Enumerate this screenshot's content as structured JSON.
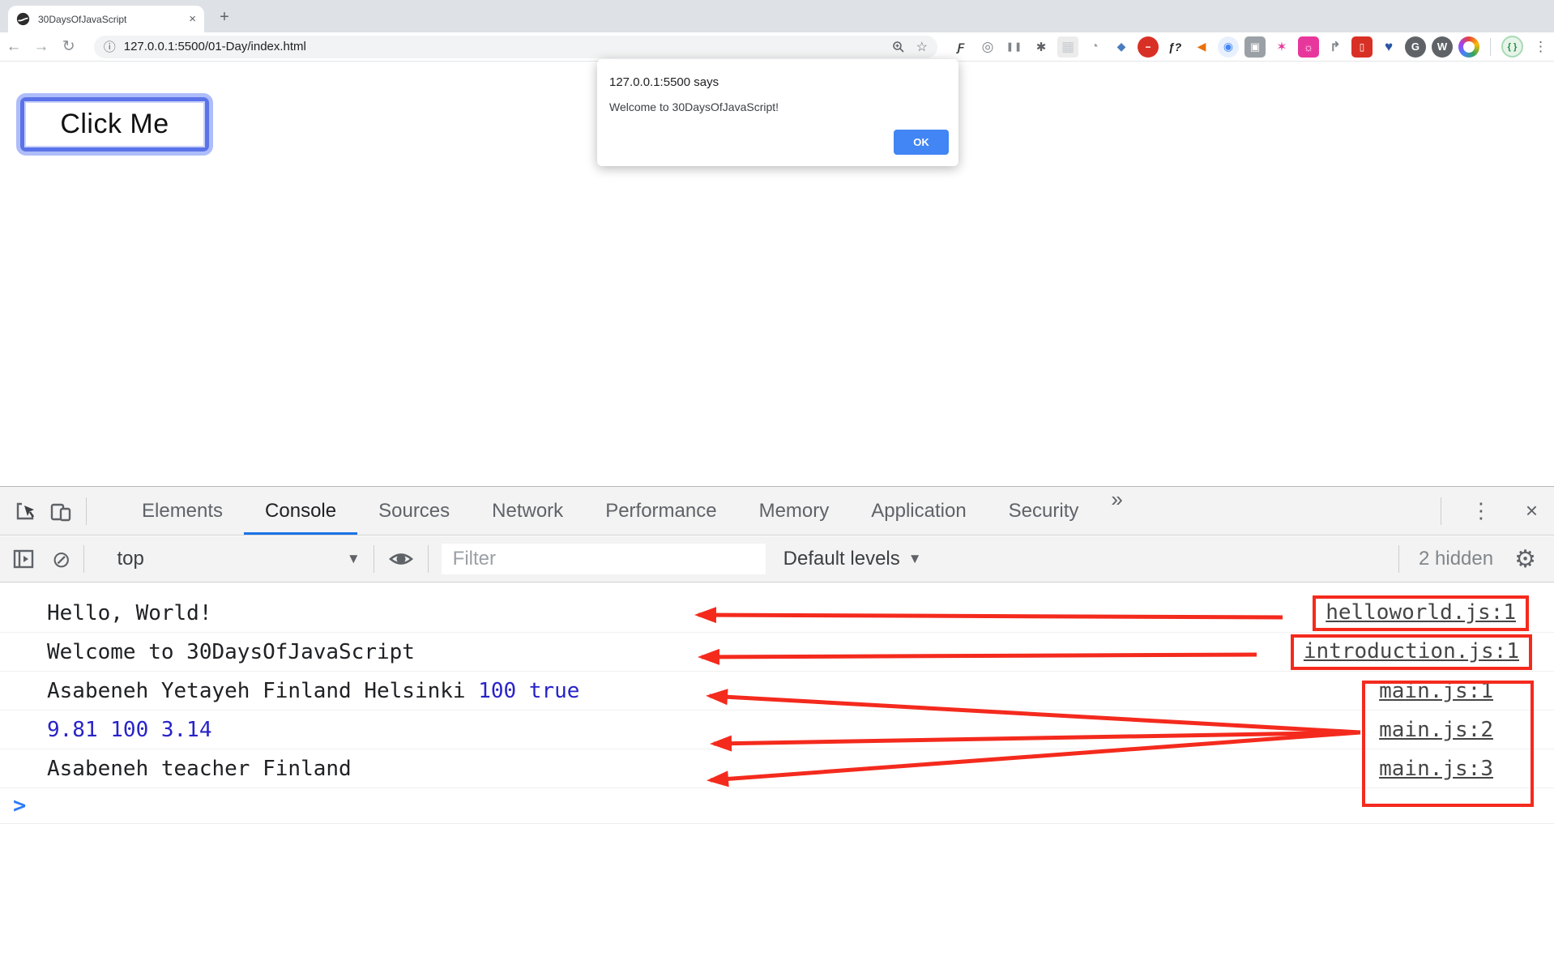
{
  "browser": {
    "tab_title": "30DaysOfJavaScript",
    "tab_close_glyph": "×",
    "newtab_glyph": "+",
    "back_glyph": "←",
    "forward_glyph": "→",
    "reload_glyph": "↻",
    "info_glyph": "ⓘ",
    "url": "127.0.0.1:5500/01-Day/index.html",
    "star_glyph": "☆",
    "accent_blue": "#4285f4",
    "extensions": [
      {
        "name": "script-f-icon",
        "glyph": "Ƒ"
      },
      {
        "name": "target-icon",
        "glyph": "◎"
      },
      {
        "name": "pause-icon",
        "glyph": "❚❚"
      },
      {
        "name": "bug-icon",
        "glyph": "✱"
      },
      {
        "name": "grid-icon",
        "glyph": "▦"
      },
      {
        "name": "timer-icon",
        "glyph": "◔"
      },
      {
        "name": "eyedropper-icon",
        "glyph": "◆"
      },
      {
        "name": "stop-hand-icon",
        "glyph": "−"
      },
      {
        "name": "fn-question-icon",
        "glyph": "ƒ?"
      },
      {
        "name": "megaphone-icon",
        "glyph": "◀"
      },
      {
        "name": "swirl-icon",
        "glyph": "◉"
      },
      {
        "name": "camera-icon",
        "glyph": "▣"
      },
      {
        "name": "pink-star-icon",
        "glyph": "✶"
      },
      {
        "name": "pink-gear-icon",
        "glyph": "☼"
      },
      {
        "name": "share-arrows-icon",
        "glyph": "↱"
      },
      {
        "name": "bookmark-red-icon",
        "glyph": "▯"
      },
      {
        "name": "heart-search-icon",
        "glyph": "♥"
      },
      {
        "name": "g-circle-icon",
        "glyph": "G"
      },
      {
        "name": "w-circle-icon",
        "glyph": "W"
      }
    ],
    "avatar_glyph": "{ }",
    "kebab_glyph": "⋮"
  },
  "page": {
    "button_label": "Click Me"
  },
  "dialog": {
    "title": "127.0.0.1:5500 says",
    "message": "Welcome to 30DaysOfJavaScript!",
    "ok_label": "OK"
  },
  "devtools": {
    "tabs": [
      {
        "label": "Elements"
      },
      {
        "label": "Console"
      },
      {
        "label": "Sources"
      },
      {
        "label": "Network"
      },
      {
        "label": "Performance"
      },
      {
        "label": "Memory"
      },
      {
        "label": "Application"
      },
      {
        "label": "Security"
      }
    ],
    "active_tab": "Console",
    "more_tabs_glyph": "»",
    "kebab_glyph": "⋮",
    "close_glyph": "×",
    "toolbar": {
      "clear_glyph": "⊘",
      "context": "top",
      "caret_glyph": "▼",
      "filter_placeholder": "Filter",
      "levels_label": "Default levels",
      "hidden_count": "2 hidden",
      "gear_glyph": "⚙"
    },
    "console": {
      "annotation_red": "#f42a1d",
      "value_blue": "#2823c8",
      "rows": [
        {
          "text": "Hello, World!",
          "value": "",
          "link": "helloworld.js:1"
        },
        {
          "text": "Welcome to 30DaysOfJavaScript",
          "value": "",
          "link": "introduction.js:1"
        },
        {
          "text": "Asabeneh Yetayeh Finland Helsinki ",
          "value": "100 true",
          "link": "main.js:1"
        },
        {
          "text": "",
          "value": "9.81 100 3.14",
          "link": "main.js:2"
        },
        {
          "text": "Asabeneh teacher Finland",
          "value": "",
          "link": "main.js:3"
        }
      ],
      "prompt_glyph": ">"
    }
  }
}
